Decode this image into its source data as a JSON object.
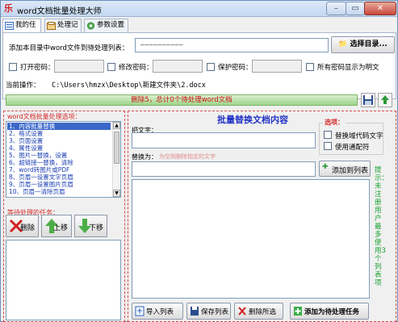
{
  "window": {
    "title": "word文档批量处理大师",
    "min_glyph": "–",
    "max_glyph": "▭",
    "close_glyph": "✕"
  },
  "tabs": [
    {
      "label": "我的任务",
      "icon": "task-icon"
    },
    {
      "label": "处理记录",
      "icon": "record-icon"
    },
    {
      "label": "参数设置",
      "icon": "settings-icon"
    }
  ],
  "source": {
    "label": "添加本目录中word文件到待处理列表：",
    "path_value": "——————————",
    "select_button": "选择目录..."
  },
  "password": {
    "open_label": "打开密码：",
    "modify_label": "修改密码：",
    "protect_label": "保护密码：",
    "show_plain_label": "所有密码显示为明文"
  },
  "current_op": {
    "label": "当前操作：",
    "value": "C:\\Users\\hmzx\\Desktop\\新建文件夹\\2.docx"
  },
  "status": {
    "text": "删除5，总计0个待处理word文档"
  },
  "left": {
    "options_title": "word文档批量处理选项：",
    "options": [
      "1、内容批量替换",
      "2、格式设置",
      "3、页面设置",
      "4、属性设置",
      "5、图片一替换，设置",
      "6、超链接一替换，清除",
      "7、word转图片或PDF",
      "8、页眉一设置文字页眉",
      "9、页眉一设置图片页眉",
      "10、页眉一清除页眉"
    ],
    "selected_index": 0,
    "pending_title": "等待处理的任务：",
    "delete_button": "删除",
    "move_up_button": "上移",
    "move_down_button": "下移"
  },
  "right": {
    "title": "批量替换文档内容",
    "find_label": "把文字：",
    "options_title": "选项：",
    "option_1": "替换域代码文字",
    "option_2": "使用通配符",
    "replace_label": "替换为：",
    "replace_hint": "为空则删除指定的文字",
    "add_list_button": "添加到列表",
    "side_note": "提示：未注册用户最多使用3个列表项",
    "import_button": "导入列表",
    "save_button": "保存列表",
    "delete_selected_button": "删除所选",
    "add_task_button": "添加为待处理任务"
  },
  "colors": {
    "accent_blue": "#2434c6",
    "warning_red": "#cc1111",
    "note_green": "#16a12d",
    "status_green": "#9fd48a"
  }
}
